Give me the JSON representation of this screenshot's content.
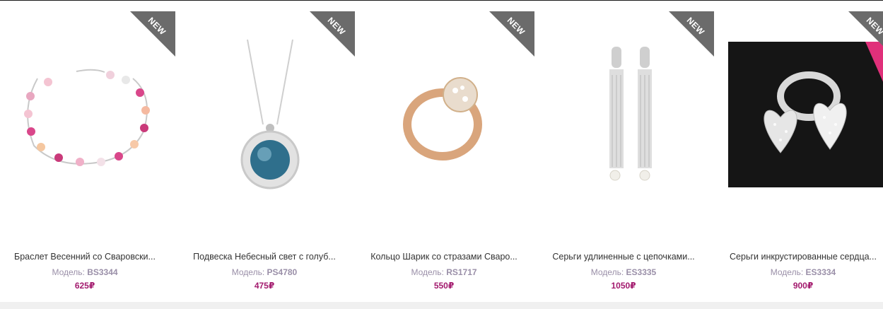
{
  "theme": {
    "accent": "#a31a6e",
    "ribbon": "#6b6b6b",
    "model_text": "#9a8fa8"
  },
  "products": [
    {
      "badge": "NEW",
      "title": "Браслет Весенний со Сваровски...",
      "model_label": "Модель:",
      "model": "BS3344",
      "price": "625₽",
      "image": "bracelet-image"
    },
    {
      "badge": "NEW",
      "title": "Подвеска Небесный свет с голуб...",
      "model_label": "Модель:",
      "model": "PS4780",
      "price": "475₽",
      "image": "pendant-image"
    },
    {
      "badge": "NEW",
      "title": "Кольцо Шарик со стразами Сваро...",
      "model_label": "Модель:",
      "model": "RS1717",
      "price": "550₽",
      "image": "ring-image"
    },
    {
      "badge": "NEW",
      "title": "Серьги удлиненные с цепочками...",
      "model_label": "Модель:",
      "model": "ES3335",
      "price": "1050₽",
      "image": "earrings-image"
    },
    {
      "badge": "NEW",
      "title": "Серьги инкрустированные сердца...",
      "model_label": "Модель:",
      "model": "ES3334",
      "price": "900₽",
      "image": "heart-earrings-image"
    }
  ]
}
